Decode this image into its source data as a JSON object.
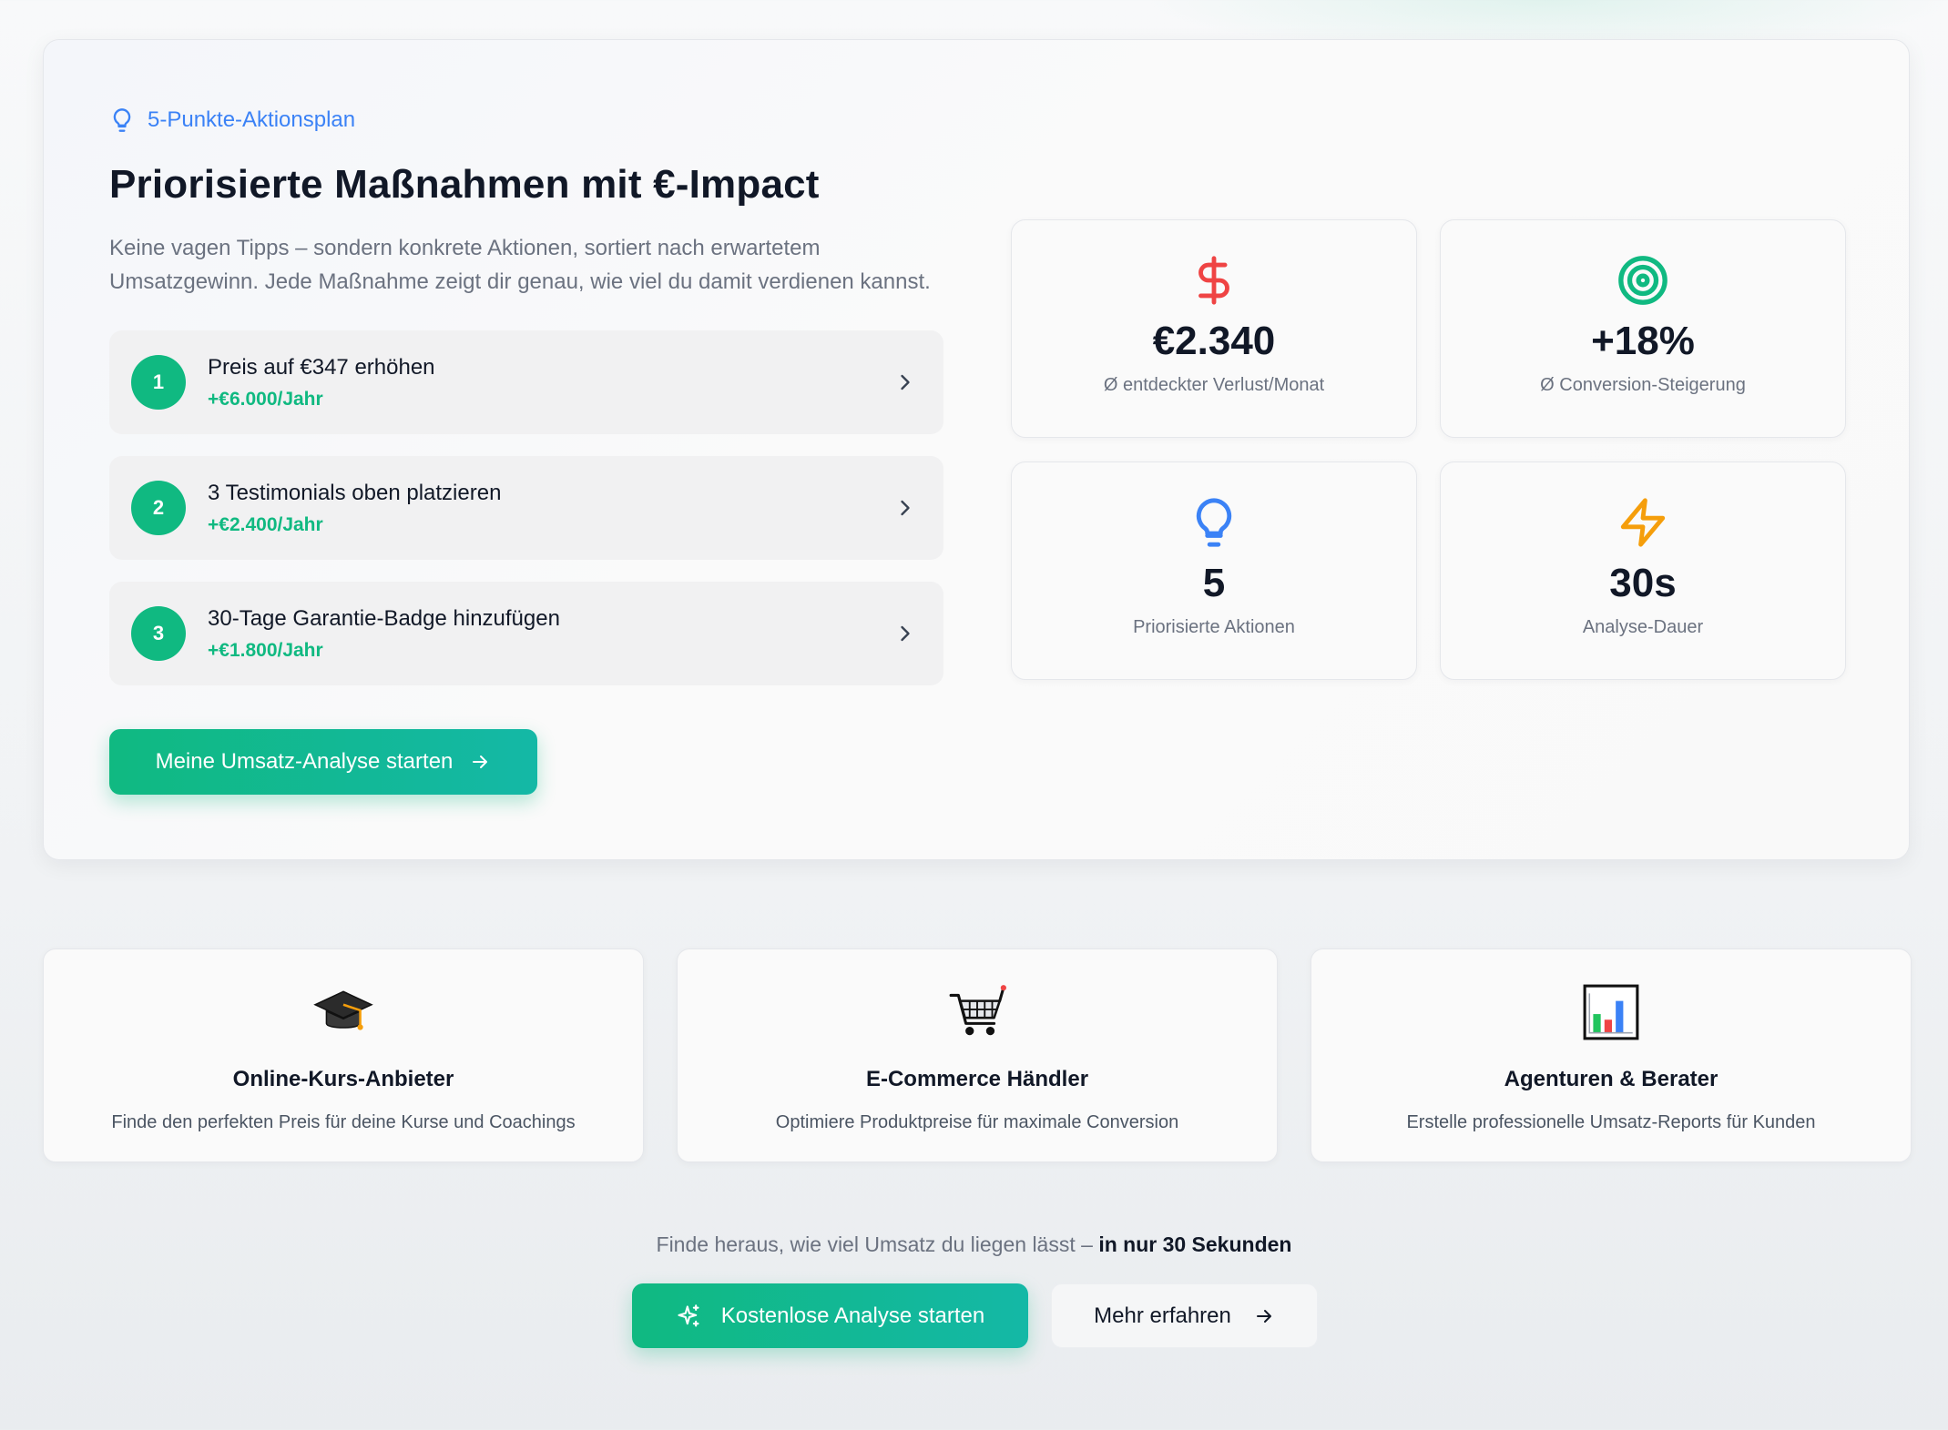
{
  "hero": {
    "eyebrow": "5-Punkte-Aktionsplan",
    "title": "Priorisierte Maßnahmen mit €-Impact",
    "description": "Keine vagen Tipps – sondern konkrete Aktionen, sortiert nach erwartetem Umsatzgewinn. Jede Maßnahme zeigt dir genau, wie viel du damit verdienen kannst.",
    "actions": [
      {
        "number": "1",
        "title": "Preis auf €347 erhöhen",
        "gain": "+€6.000/Jahr"
      },
      {
        "number": "2",
        "title": "3 Testimonials oben platzieren",
        "gain": "+€2.400/Jahr"
      },
      {
        "number": "3",
        "title": "30-Tage Garantie-Badge hinzufügen",
        "gain": "+€1.800/Jahr"
      }
    ],
    "cta_label": "Meine Umsatz-Analyse starten"
  },
  "stats": [
    {
      "icon": "dollar-icon",
      "value": "€2.340",
      "label": "Ø entdeckter Verlust/Monat",
      "color": "#ef4444"
    },
    {
      "icon": "target-icon",
      "value": "+18%",
      "label": "Ø Conversion-Steigerung",
      "color": "#10b981"
    },
    {
      "icon": "lightbulb-icon",
      "value": "5",
      "label": "Priorisierte Aktionen",
      "color": "#3b82f6"
    },
    {
      "icon": "lightning-icon",
      "value": "30s",
      "label": "Analyse-Dauer",
      "color": "#f59e0b"
    }
  ],
  "audiences": [
    {
      "icon": "graduation-cap-icon",
      "title": "Online-Kurs-Anbieter",
      "description": "Finde den perfekten Preis für deine Kurse und Coachings"
    },
    {
      "icon": "shopping-cart-icon",
      "title": "E-Commerce Händler",
      "description": "Optimiere Produktpreise für maximale Conversion"
    },
    {
      "icon": "bar-chart-icon",
      "title": "Agenturen & Berater",
      "description": "Erstelle professionelle Umsatz-Reports für Kunden"
    }
  ],
  "bottom": {
    "text": "Finde heraus, wie viel Umsatz du liegen lässt –",
    "text_bold": "in nur 30 Sekunden",
    "primary_label": "Kostenlose Analyse starten",
    "secondary_label": "Mehr erfahren"
  },
  "colors": {
    "accent": "#10b981",
    "accent_alt": "#14b8a6",
    "link": "#3b82f6"
  }
}
